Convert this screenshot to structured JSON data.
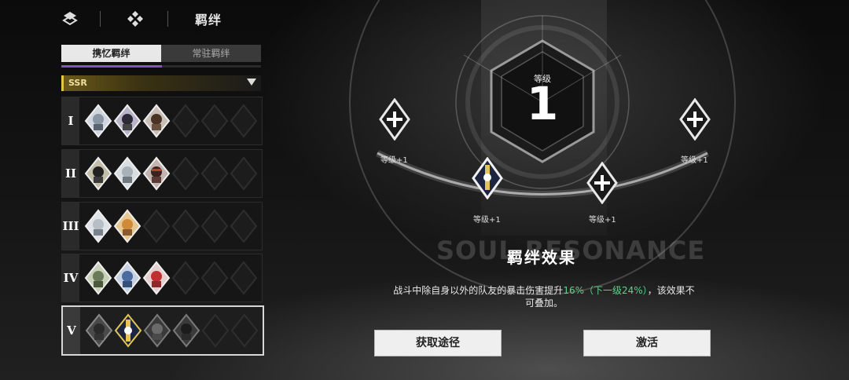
{
  "header": {
    "title": "羁绊"
  },
  "tabs": [
    {
      "label": "携忆羁绊",
      "active": true
    },
    {
      "label": "常驻羁绊",
      "active": false
    }
  ],
  "rarity_filter": {
    "value": "SSR"
  },
  "bond_rows": [
    {
      "numeral": "I",
      "filled": 3,
      "slots": 6,
      "selected": false
    },
    {
      "numeral": "II",
      "filled": 3,
      "slots": 6,
      "selected": false
    },
    {
      "numeral": "III",
      "filled": 2,
      "slots": 6,
      "selected": false
    },
    {
      "numeral": "IV",
      "filled": 3,
      "slots": 6,
      "selected": false
    },
    {
      "numeral": "V",
      "filled": 4,
      "slots": 6,
      "selected": true
    }
  ],
  "level": {
    "label": "等级",
    "value": "1"
  },
  "nodes": [
    {
      "label": "等级+1",
      "type": "plus"
    },
    {
      "label": "等级+1",
      "type": "character"
    },
    {
      "label": "等级+1",
      "type": "plus"
    },
    {
      "label": "等级+1",
      "type": "plus"
    }
  ],
  "background_text": "SOUL RESONANCE",
  "effect": {
    "title": "羁绊效果",
    "desc_before": "战斗中除自身以外的队友的暴击伤害提升",
    "value": "16%",
    "next": "（下一级24%）",
    "desc_after": "，该效果不可叠加。"
  },
  "buttons": {
    "obtain": "获取途径",
    "activate": "激活"
  },
  "colors": {
    "highlight": "#5fd08a",
    "rarity_accent": "#e8c443",
    "tab_underline": "#8a4ec8"
  }
}
